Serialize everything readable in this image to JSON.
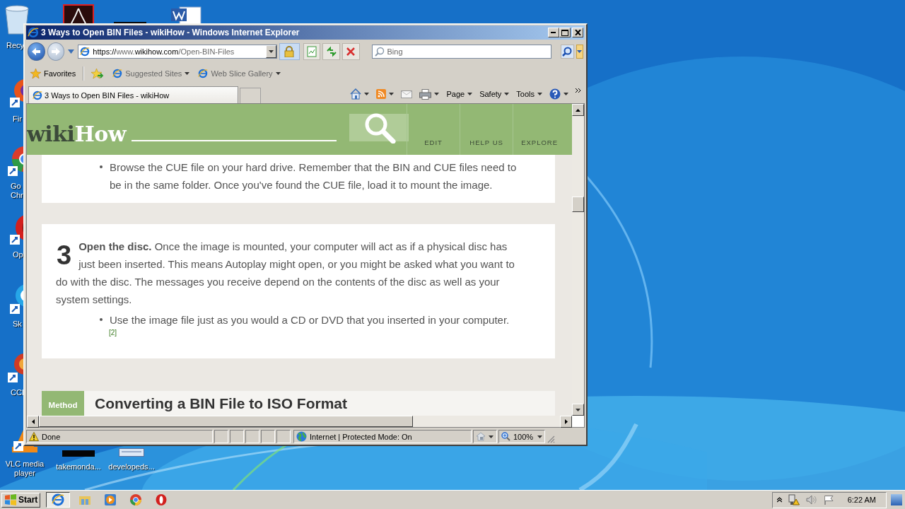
{
  "desktop_icons": [
    {
      "kind": "recycle-bin",
      "label": "Recy"
    },
    {
      "kind": "pdf"
    },
    {
      "kind": "black-app"
    },
    {
      "kind": "word"
    },
    {
      "kind": "firefox",
      "label": "Fir"
    },
    {
      "kind": "chrome",
      "label": "Go Chr"
    },
    {
      "kind": "opera",
      "label": "Op"
    },
    {
      "kind": "skype",
      "label": "Sk"
    },
    {
      "kind": "ccleaner",
      "label": "CCl"
    },
    {
      "kind": "vlc",
      "label": "VLC media player"
    },
    {
      "kind": "black-app",
      "label": "takemonda..."
    },
    {
      "kind": "window-file",
      "label": "developeds..."
    }
  ],
  "window": {
    "title": "3 Ways to Open BIN Files - wikiHow - Windows Internet Explorer",
    "address": [
      {
        "text": "https://",
        "strong": true
      },
      {
        "text": "www.",
        "strong": false
      },
      {
        "text": "wikihow.com",
        "strong": true
      },
      {
        "text": "/Open-BIN-Files",
        "strong": false
      }
    ],
    "search": {
      "placeholder": "Bing"
    },
    "favorites_bar": {
      "label": "Favorites",
      "items": [
        "Suggested Sites",
        "Web Slice Gallery"
      ]
    },
    "tabs": [
      {
        "title": "3 Ways to Open BIN Files - wikiHow",
        "selected": true
      }
    ],
    "command_bar": [
      "Page",
      "Safety",
      "Tools"
    ],
    "page": {
      "logo": [
        "wiki",
        "How"
      ],
      "nav": [
        "EDIT",
        "HELP US",
        "EXPLORE"
      ],
      "card_bullets": [
        "Browse the CUE file on your hard drive. Remember that the BIN and CUE files need to be in the same folder. Once you've found the CUE file, load it to mount the image."
      ],
      "step": {
        "number": "3",
        "text": "**Open the disc.** Once the image is mounted, your computer will act as if a physical disc has just been inserted. This means Autoplay might open, or you might be asked what you want to do with the disc. The messages you receive depend on the contents of the disc as well as your system settings.",
        "bullets": [
          {
            "text": "Use the image file just as you would a CD or DVD that you inserted in your computer.",
            "ref": "[2]"
          }
        ]
      },
      "method": {
        "badge": "Method",
        "title": "Converting a BIN File to ISO Format"
      }
    },
    "status_bar": {
      "text": "Done",
      "zone": "Internet | Protected Mode: On",
      "zoom": "100%"
    }
  },
  "taskbar": {
    "start": "Start",
    "apps": [
      {
        "kind": "ie",
        "selected": true
      },
      {
        "kind": "explorer",
        "selected": false
      },
      {
        "kind": "media-player",
        "selected": false
      },
      {
        "kind": "chrome",
        "selected": false
      },
      {
        "kind": "opera",
        "selected": false
      }
    ],
    "clock": "6:22 AM"
  }
}
